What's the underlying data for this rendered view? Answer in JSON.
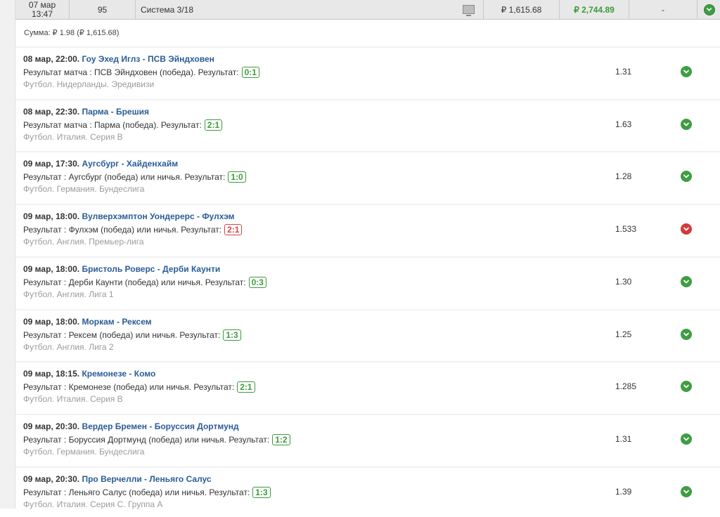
{
  "header_row": {
    "date_line1": "07 мар",
    "date_line2": "13:47",
    "bet_number": "95",
    "bet_type": "Система 3/18",
    "stake": "₽ 1,615.68",
    "win": "₽ 2,744.89",
    "dash": "-",
    "status": "win"
  },
  "summary": "Сумма: ₽ 1.98 (₽ 1,615.68)",
  "result_label": "Результат:",
  "bets": [
    {
      "datetime": "08 мар, 22:00.",
      "match": "Гоу Эхед Иглз - ПСВ Эйндховен",
      "selection": "Результат матча : ПСВ Эйндховен (победа). Результат:",
      "score": "0:1",
      "league": "Футбол. Нидерланды. Эредивизи",
      "odds": "1.31",
      "status": "win"
    },
    {
      "datetime": "08 мар, 22:30.",
      "match": "Парма - Брешия",
      "selection": "Результат матча : Парма (победа). Результат:",
      "score": "2:1",
      "league": "Футбол. Италия. Серия B",
      "odds": "1.63",
      "status": "win"
    },
    {
      "datetime": "09 мар, 17:30.",
      "match": "Аугсбург - Хайденхайм",
      "selection": "Результат : Аугсбург (победа) или ничья. Результат:",
      "score": "1:0",
      "league": "Футбол. Германия. Бундеслига",
      "odds": "1.28",
      "status": "win"
    },
    {
      "datetime": "09 мар, 18:00.",
      "match": "Вулверхэмптон Уондерерс - Фулхэм",
      "selection": "Результат : Фулхэм (победа) или ничья. Результат:",
      "score": "2:1",
      "league": "Футбол. Англия. Премьер-лига",
      "odds": "1.533",
      "status": "lose"
    },
    {
      "datetime": "09 мар, 18:00.",
      "match": "Бристоль Роверс - Дерби Каунти",
      "selection": "Результат : Дерби Каунти (победа) или ничья. Результат:",
      "score": "0:3",
      "league": "Футбол. Англия. Лига 1",
      "odds": "1.30",
      "status": "win"
    },
    {
      "datetime": "09 мар, 18:00.",
      "match": "Моркам - Рексем",
      "selection": "Результат : Рексем (победа) или ничья. Результат:",
      "score": "1:3",
      "league": "Футбол. Англия. Лига 2",
      "odds": "1.25",
      "status": "win"
    },
    {
      "datetime": "09 мар, 18:15.",
      "match": "Кремонезе - Комо",
      "selection": "Результат : Кремонезе (победа) или ничья. Результат:",
      "score": "2:1",
      "league": "Футбол. Италия. Серия B",
      "odds": "1.285",
      "status": "win"
    },
    {
      "datetime": "09 мар, 20:30.",
      "match": "Вердер Бремен - Боруссия Дортмунд",
      "selection": "Результат : Боруссия Дортмунд (победа) или ничья. Результат:",
      "score": "1:2",
      "league": "Футбол. Германия. Бундеслига",
      "odds": "1.31",
      "status": "win"
    },
    {
      "datetime": "09 мар, 20:30.",
      "match": "Про Верчелли - Леньяго Салус",
      "selection": "Результат : Леньяго Салус (победа) или ничья. Результат:",
      "score": "1:3",
      "league": "Футбол. Италия. Серия C. Группа A",
      "odds": "1.39",
      "status": "win"
    }
  ],
  "colors": {
    "win": "#3f9d43",
    "lose": "#d33a3a",
    "match_link": "#2a5c96"
  },
  "icons": {
    "status_win": "check-circle-icon",
    "status_lose": "chevron-down-circle-icon",
    "monitor": "monitor-icon"
  }
}
